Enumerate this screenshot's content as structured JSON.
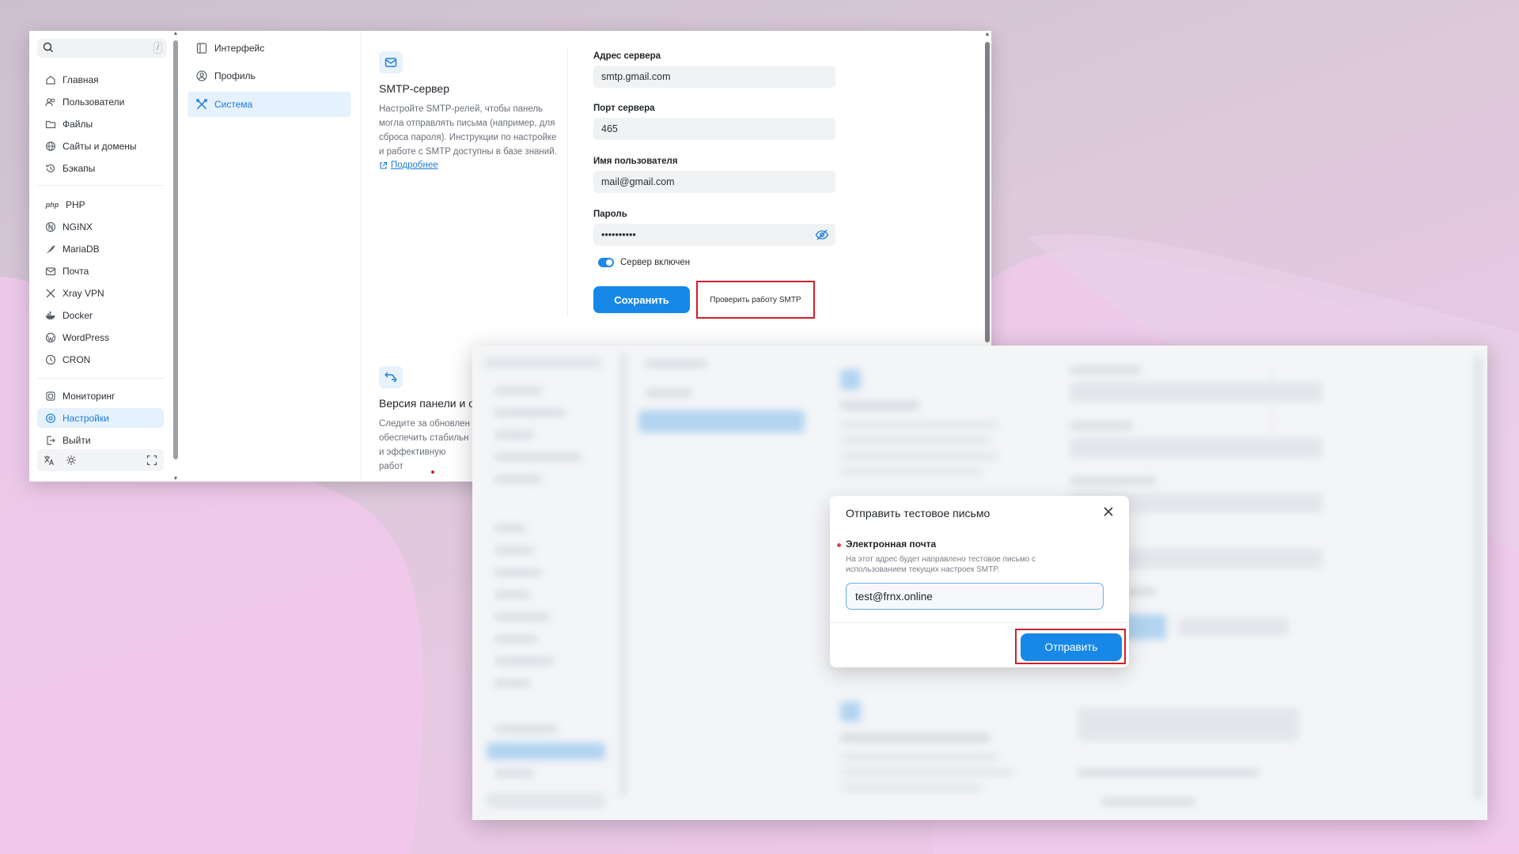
{
  "window1": {
    "search": {
      "kbd_hint": "/"
    },
    "sidebar": {
      "items": [
        {
          "label": "Главная",
          "icon": "home-icon"
        },
        {
          "label": "Пользователи",
          "icon": "users-icon"
        },
        {
          "label": "Файлы",
          "icon": "folder-icon"
        },
        {
          "label": "Сайты и домены",
          "icon": "globe-icon"
        },
        {
          "label": "Бэкапы",
          "icon": "history-icon"
        },
        {
          "label": "PHP",
          "icon": "php-icon"
        },
        {
          "label": "NGINX",
          "icon": "nginx-icon"
        },
        {
          "label": "MariaDB",
          "icon": "mariadb-icon"
        },
        {
          "label": "Почта",
          "icon": "mail-icon"
        },
        {
          "label": "Xray VPN",
          "icon": "xray-icon"
        },
        {
          "label": "Docker",
          "icon": "docker-icon"
        },
        {
          "label": "WordPress",
          "icon": "wordpress-icon"
        },
        {
          "label": "CRON",
          "icon": "clock-icon"
        },
        {
          "label": "Мониторинг",
          "icon": "monitor-icon"
        },
        {
          "label": "Настройки",
          "icon": "settings-icon",
          "active": true
        },
        {
          "label": "Выйти",
          "icon": "logout-icon"
        }
      ],
      "php_glyph": "php"
    },
    "subnav": {
      "items": [
        {
          "label": "Интерфейс",
          "icon": "layout-icon"
        },
        {
          "label": "Профиль",
          "icon": "profile-icon"
        },
        {
          "label": "Система",
          "icon": "tools-icon",
          "active": true
        }
      ]
    },
    "smtp_section": {
      "title": "SMTP-сервер",
      "description": "Настройте SMTP-релей, чтобы панель могла отправлять письма (например, для сброса пароля). Инструкции по настройке и работе с SMTP доступны в базе знаний.",
      "link": "Подробнее"
    },
    "form": {
      "server_address_label": "Адрес сервера",
      "server_address_value": "smtp.gmail.com",
      "port_label": "Порт сервера",
      "port_value": "465",
      "username_label": "Имя пользователя",
      "username_value": "mail@gmail.com",
      "password_label": "Пароль",
      "password_value": "••••••••••",
      "toggle_label": "Сервер включен",
      "toggle_on": true,
      "save_button": "Сохранить",
      "test_button": "Проверить работу SMTP"
    },
    "version_section": {
      "title": "Версия панели и о",
      "description": "Следите за обновлен обеспечить стабильн и эффективную работ"
    },
    "colors": {
      "accent": "#1788e8",
      "highlight": "#d0202a"
    }
  },
  "modal": {
    "title": "Отправить тестовое письмо",
    "field_label": "Электронная почта",
    "field_help": "На этот адрес будет направлено тестовое письмо с использованием текущих настроек SMTP.",
    "email_value": "test@frnx.online",
    "send_button": "Отправить"
  }
}
